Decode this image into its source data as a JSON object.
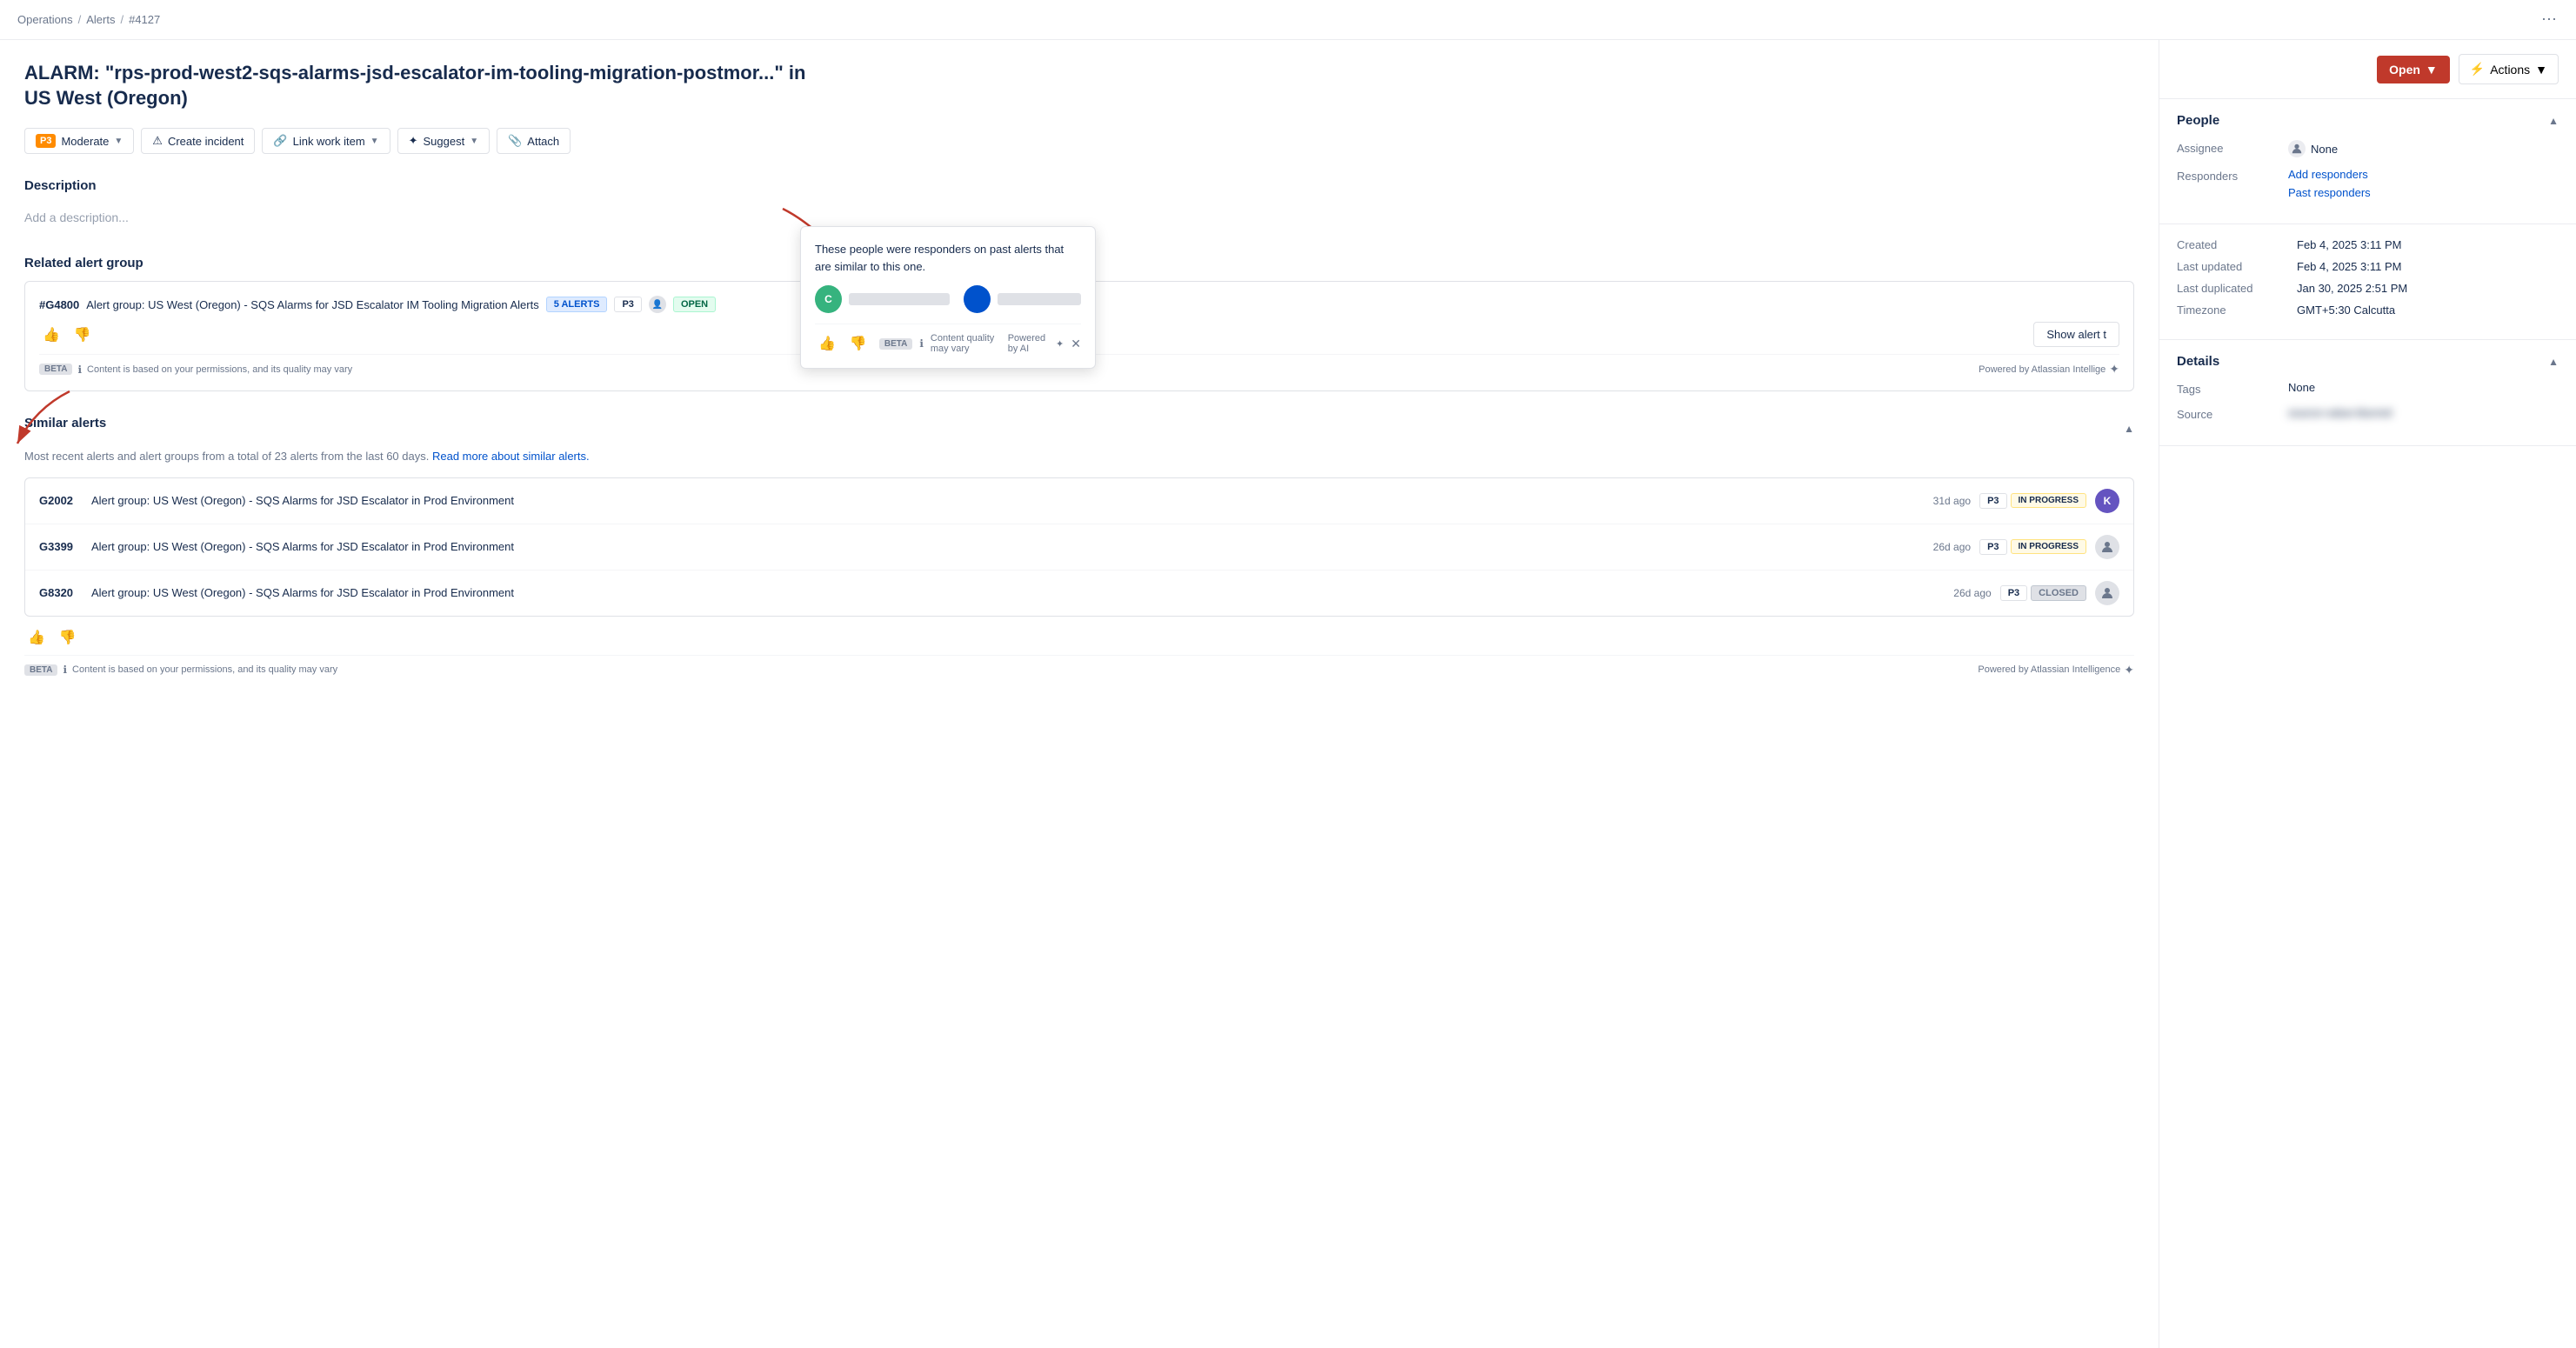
{
  "breadcrumb": {
    "items": [
      "Operations",
      "Alerts",
      "#4127"
    ],
    "separators": [
      "/",
      "/"
    ]
  },
  "page": {
    "title": "ALARM: \"rps-prod-west2-sqs-alarms-jsd-escalator-im-tooling-migration-postmor...\" in US West (Oregon)",
    "more_icon": "⋯"
  },
  "toolbar": {
    "priority": {
      "badge": "P3",
      "label": "Moderate",
      "has_dropdown": true
    },
    "buttons": [
      {
        "id": "create-incident",
        "label": "Create incident",
        "icon": "⚠",
        "has_dropdown": false
      },
      {
        "id": "link-work-item",
        "label": "Link work item",
        "icon": "🔗",
        "has_dropdown": true
      },
      {
        "id": "suggest",
        "label": "Suggest",
        "icon": "✦",
        "has_dropdown": true
      },
      {
        "id": "attach",
        "label": "Attach",
        "icon": "📎",
        "has_dropdown": false
      }
    ]
  },
  "description": {
    "label": "Description",
    "placeholder": "Add a description..."
  },
  "related_alert_group": {
    "label": "Related alert group",
    "card": {
      "id": "#G4800",
      "title": "Alert group: US West (Oregon) - SQS Alarms for JSD Escalator IM Tooling Migration Alerts",
      "badge_alerts": "5 ALERTS",
      "badge_priority": "P3",
      "badge_status": "OPEN",
      "show_alert_label": "Show alert t",
      "ai_note": "Content is based on your permissions, and its quality may vary",
      "ai_powered": "Powered by Atlassian Intellige"
    }
  },
  "similar_alerts": {
    "label": "Similar alerts",
    "description": "Most recent alerts and alert groups from a total of 23 alerts from the last 60 days.",
    "read_more_link": "Read more about similar alerts.",
    "items": [
      {
        "id": "G2002",
        "title": "Alert group: US West (Oregon) - SQS Alarms for JSD Escalator in Prod Environment",
        "time": "31d ago",
        "priority": "P3",
        "status": "IN PROGRESS",
        "has_avatar": true,
        "avatar_color": "#6554c0",
        "avatar_initial": "K"
      },
      {
        "id": "G3399",
        "title": "Alert group: US West (Oregon) - SQS Alarms for JSD Escalator in Prod Environment",
        "time": "26d ago",
        "priority": "P3",
        "status": "IN PROGRESS",
        "has_avatar": false
      },
      {
        "id": "G8320",
        "title": "Alert group: US West (Oregon) - SQS Alarms for JSD Escalator in Prod Environment",
        "time": "26d ago",
        "priority": "P3",
        "status": "CLOSED",
        "has_avatar": false
      }
    ],
    "ai_note": "Content is based on your permissions, and its quality may vary",
    "ai_powered": "Powered by Atlassian Intelligence"
  },
  "sidebar": {
    "open_button": "Open",
    "actions_button": "Actions",
    "people_section": {
      "title": "People",
      "assignee_label": "Assignee",
      "assignee_value": "None",
      "responders_label": "Responders",
      "add_responders_label": "Add responders",
      "past_responders_label": "Past responders"
    },
    "tooltip": {
      "text": "These people were responders on past alerts that are similar to this one.",
      "avatar1_initial": "C",
      "avatar1_color": "#36b37e",
      "avatar2_color": "#0052cc"
    },
    "timestamps": {
      "created_label": "Created",
      "created_value": "Feb 4, 2025 3:11 PM",
      "last_updated_label": "Last updated",
      "last_updated_value": "Feb 4, 2025 3:11 PM",
      "last_duplicated_label": "Last duplicated",
      "last_duplicated_value": "Jan 30, 2025 2:51 PM",
      "timezone_label": "Timezone",
      "timezone_value": "GMT+5:30 Calcutta"
    },
    "details_section": {
      "title": "Details",
      "tags_label": "Tags",
      "tags_value": "None",
      "source_label": "Source",
      "source_value": "blurred-source-value"
    }
  }
}
